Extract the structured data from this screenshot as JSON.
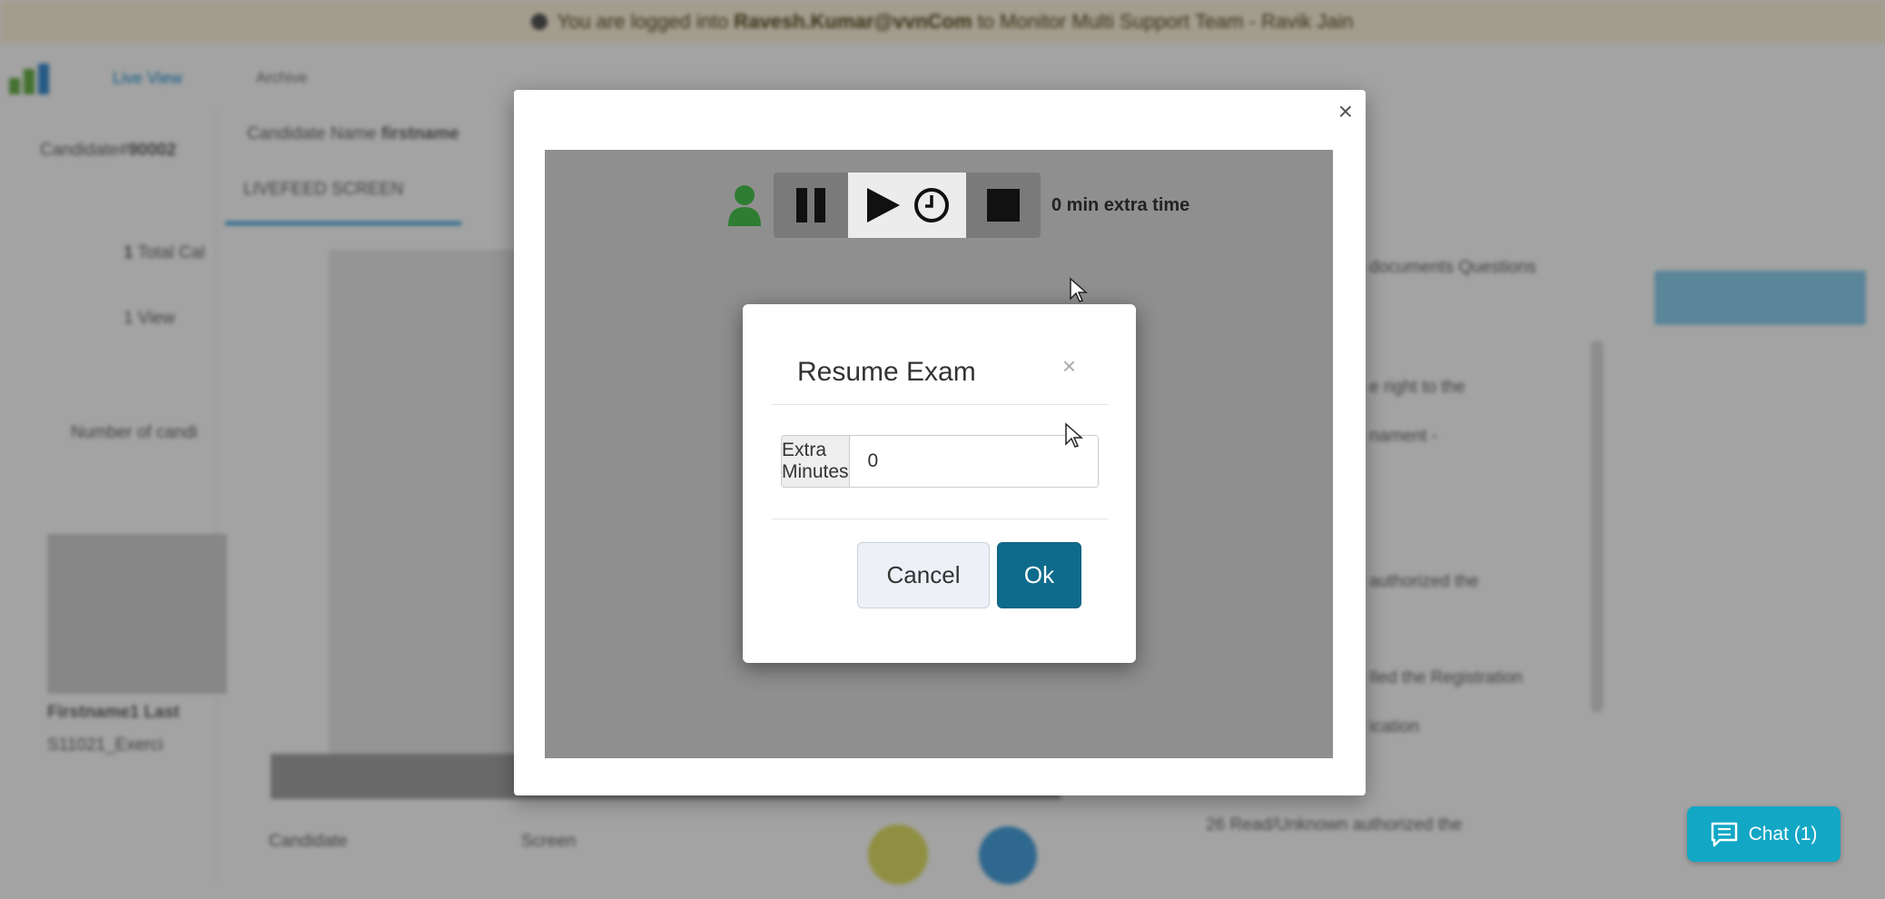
{
  "background": {
    "banner": {
      "prefix": "You are logged into",
      "email": "Ravesh.Kumar@vvnCom",
      "middle": "to Monitor Multi Support Team",
      "suffix": "- Ravik Jain"
    },
    "nav": {
      "active": "Live View",
      "second": "Archive"
    },
    "candidate_id_label": "Candidate#",
    "candidate_id": "90002",
    "candidate_name_label": "Candidate Name",
    "candidate_name": "firstname",
    "tab_livefeed": "LIVEFEED SCREEN",
    "total_label": "Total Cal",
    "total_count": "1",
    "view_count": "1",
    "view_label": "View",
    "number_label": "Number of candi",
    "thumb_name": "Firstname1 Last",
    "thumb_id": "S11021_Exerci",
    "bottom_candidate": "Candidate",
    "bottom_screen": "Screen",
    "right_texts": [
      "documents Questions",
      "e right to the",
      "nament -",
      "authorized the",
      "Iled the Registration",
      "ication",
      "26 Read/Unknown authorized the"
    ]
  },
  "modal": {
    "close_symbol": "×",
    "extra_time_label": "0 min extra time",
    "icons": {
      "candidate": "person-icon",
      "pause": "pause-icon",
      "resume": "play-icon",
      "timer": "clock-icon",
      "stop": "stop-icon"
    }
  },
  "resume_dialog": {
    "title": "Resume Exam",
    "close_symbol": "×",
    "extra_minutes_label": "Extra Minutes",
    "extra_minutes_value": "0",
    "cancel_label": "Cancel",
    "ok_label": "Ok"
  },
  "chat": {
    "label": "Chat (1)",
    "icon": "chat-icon"
  },
  "colors": {
    "ok_button": "#0f6b8c",
    "chat_button": "#13a7c6",
    "person_icon": "#2e7d32",
    "video_area": "#8f8f8f"
  }
}
